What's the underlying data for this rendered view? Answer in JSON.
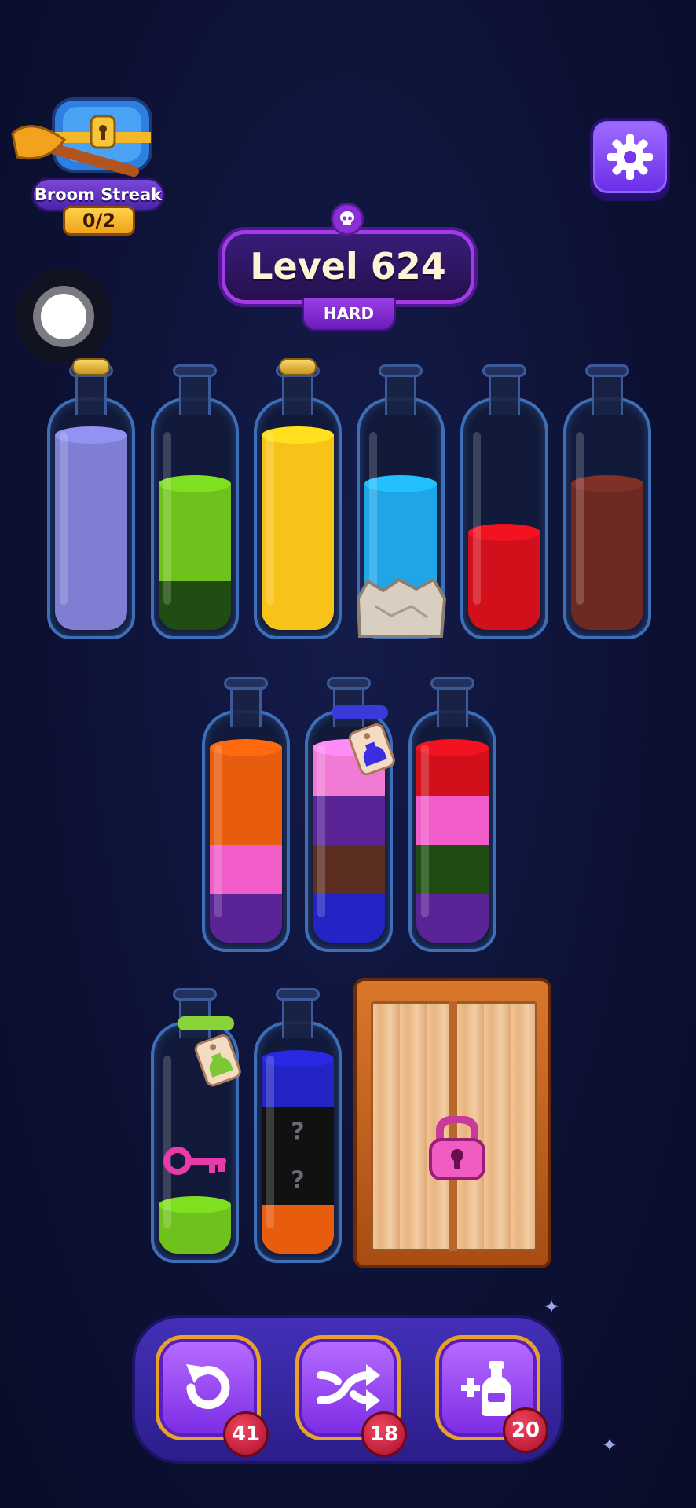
{
  "hud": {
    "streak_title": "Broom Streak",
    "streak_count": "0/2",
    "level_title": "Level 624",
    "difficulty": "HARD"
  },
  "bottles_row1": [
    {
      "cork": true,
      "layers": [
        "#7e7fd2",
        "#7e7fd2",
        "#7e7fd2",
        "#7e7fd2"
      ]
    },
    {
      "cork": false,
      "layers": [
        "#1f4d12",
        "#6fc21c",
        "#6fc21c"
      ]
    },
    {
      "cork": true,
      "layers": [
        "#f7c318",
        "#f7c318",
        "#f7c318",
        "#f7c318"
      ]
    },
    {
      "cork": false,
      "layers": [
        "#1fa6e6",
        "#1fa6e6",
        "#1fa6e6"
      ],
      "stones": true
    },
    {
      "cork": false,
      "layers": [
        "#d2101c",
        "#d2101c"
      ]
    },
    {
      "cork": false,
      "layers": [
        "#6e2a22",
        "#6e2a22",
        "#6e2a22"
      ]
    }
  ],
  "bottles_row2": [
    {
      "layers": [
        "#5a2496",
        "#f05cc8",
        "#e85c0e",
        "#e85c0e"
      ]
    },
    {
      "layers": [
        "#2424c4",
        "#5c2e22",
        "#5a2496",
        "#f07ad4"
      ],
      "tag": "blue"
    },
    {
      "layers": [
        "#5a2496",
        "#1f4d12",
        "#f05cc8",
        "#d2101c"
      ]
    }
  ],
  "bottles_row3": [
    {
      "layers": [
        "#6fc21c"
      ],
      "tag": "green",
      "key": true
    },
    {
      "layers": [
        "#e85c0e",
        "#111111",
        "#111111",
        "#2424c4"
      ],
      "hidden": [
        false,
        true,
        true,
        false
      ],
      "hidden_mark": "?"
    }
  ],
  "tools": {
    "undo_count": "41",
    "shuffle_count": "18",
    "add_bottle_count": "20"
  },
  "icons": [
    "treasure-chest-icon",
    "broom-icon",
    "gear-icon",
    "skull-icon",
    "undo-icon",
    "shuffle-icon",
    "add-bottle-icon",
    "padlock-icon",
    "key-icon"
  ]
}
